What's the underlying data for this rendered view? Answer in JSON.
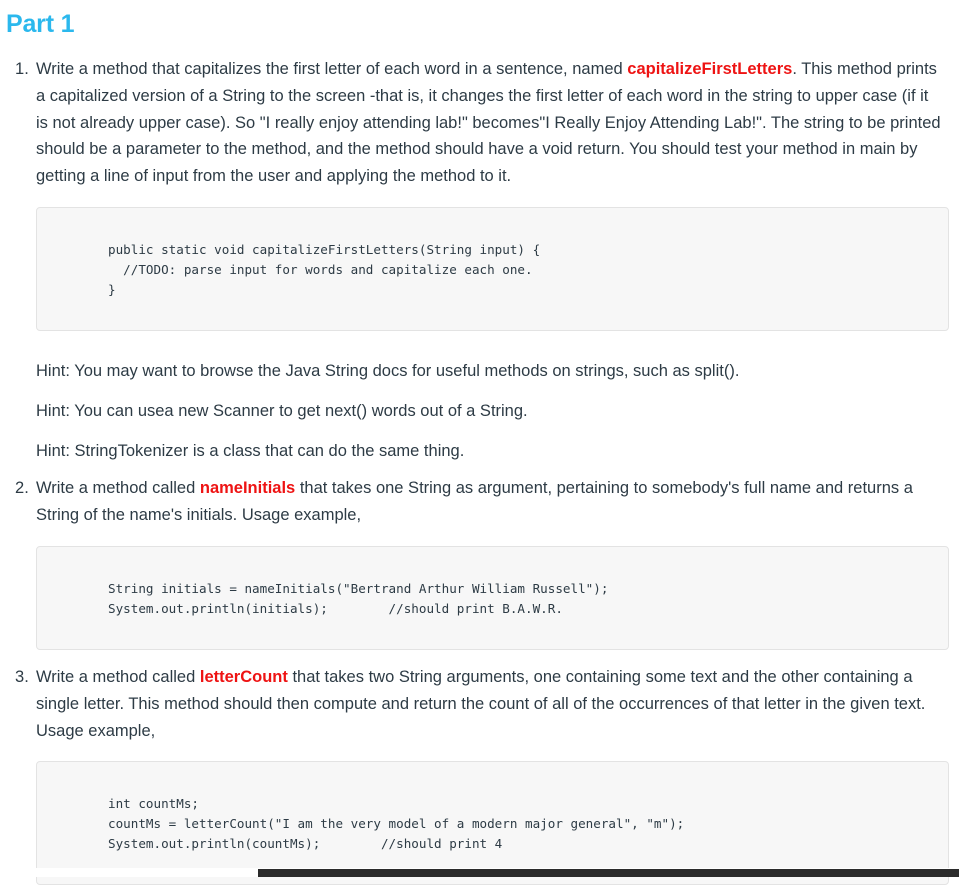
{
  "document": {
    "title": "Part 1",
    "title_color": "#2bb8ed",
    "highlight_color": "#ee1313",
    "body_text_color": "#2d3b45",
    "code_background": "#f7f7f7",
    "code_border": "#e3e3e3"
  },
  "tasks": [
    {
      "number": "1.",
      "paragraph_part1": "Write a method that capitalizes the first letter of each word in a sentence, named ",
      "highlight": "capitalizeFirstLetters",
      "paragraph_part2": ". This method prints a capitalized version of a String to the screen -that is, it changes the first letter of each word in the string to upper case (if it is not already upper case). So \"I really enjoy attending lab!\" becomes\"I Really Enjoy Attending Lab!\". The string to be printed should be a parameter to the method, and the method should have a void return. You should test your method in main by getting a line of input from the user and applying the method to it.",
      "code": "public static void capitalizeFirstLetters(String input) {\n  //TODO: parse input for words and capitalize each one.\n}",
      "hints": [
        "Hint: You may want to browse the Java String docs for useful methods on strings, such as split().",
        "Hint: You can usea new Scanner to get next() words out of a String.",
        "Hint: StringTokenizer is a class that can do the same thing."
      ]
    },
    {
      "number": "2.",
      "paragraph_part1": "Write a method called ",
      "highlight": "nameInitials",
      "paragraph_part2": " that takes one String as argument, pertaining to somebody's full name and returns a String of the name's initials. Usage example,",
      "code": "String initials = nameInitials(\"Bertrand Arthur William Russell\");\nSystem.out.println(initials);        //should print B.A.W.R.",
      "hints": []
    },
    {
      "number": "3.",
      "paragraph_part1": "Write a method called ",
      "highlight": "letterCount",
      "paragraph_part2": " that takes two String arguments, one containing some text and the other containing a single letter. This method should then compute and return the count of all of the occurrences of that letter in the given text. Usage example,",
      "code": "int countMs;\ncountMs = letterCount(\"I am the very model of a modern major general\", \"m\");\nSystem.out.println(countMs);        //should print 4",
      "hints": []
    }
  ],
  "scrollbar": {
    "orientation": "horizontal",
    "thumb_color": "#2b2b2b",
    "track_color": "#ffffff"
  }
}
